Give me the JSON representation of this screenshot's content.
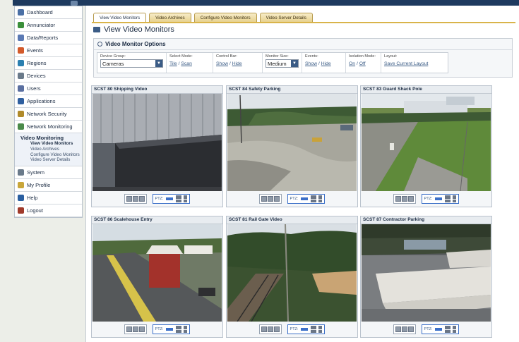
{
  "sidebar": {
    "items": [
      {
        "label": "Dashboard",
        "icon": "dashboard-icon",
        "color": "#4a6fa5"
      },
      {
        "label": "Annunciator",
        "icon": "annunciator-icon",
        "color": "#3a8f3a"
      },
      {
        "label": "Data/Reports",
        "icon": "reports-icon",
        "color": "#5a79b3"
      },
      {
        "label": "Events",
        "icon": "events-icon",
        "color": "#d35a2a"
      },
      {
        "label": "Regions",
        "icon": "regions-icon",
        "color": "#2a7fb0"
      },
      {
        "label": "Devices",
        "icon": "devices-icon",
        "color": "#6a7a8a"
      },
      {
        "label": "Users",
        "icon": "users-icon",
        "color": "#5a6fa0"
      },
      {
        "label": "Applications",
        "icon": "applications-icon",
        "color": "#2f5f9f"
      },
      {
        "label": "Network Security",
        "icon": "network-security-icon",
        "color": "#b08a2a"
      },
      {
        "label": "Network Monitoring",
        "icon": "network-monitoring-icon",
        "color": "#4a8a4a"
      }
    ],
    "video_monitoring": {
      "label": "Video Monitoring",
      "subitems": [
        "View Video Monitors",
        "Video Archives",
        "Configure Video Monitors",
        "Video Server Details"
      ]
    },
    "bottom_items": [
      {
        "label": "System",
        "icon": "system-icon",
        "color": "#6a7a8a"
      },
      {
        "label": "My Profile",
        "icon": "profile-icon",
        "color": "#c9a63a"
      },
      {
        "label": "Help",
        "icon": "help-icon",
        "color": "#2a5fa0"
      },
      {
        "label": "Logout",
        "icon": "logout-icon",
        "color": "#a03a2a"
      }
    ]
  },
  "tabs": [
    "View Video Monitors",
    "Video Archives",
    "Configure Video Monitors",
    "Video Server Details"
  ],
  "page_title": "View Video Monitors",
  "options": {
    "header": "Video Monitor Options",
    "device_group_label": "Device Group:",
    "device_group_value": "Cameras",
    "select_mode_label": "Select Mode:",
    "select_mode_a": "Tile",
    "select_mode_b": "Scan",
    "control_bar_label": "Control Bar:",
    "control_bar_a": "Show",
    "control_bar_b": "Hide",
    "monitor_size_label": "Monitor Size:",
    "monitor_size_value": "Medium",
    "events_label": "Events:",
    "events_a": "Show",
    "events_b": "Hide",
    "isolation_label": "Isolation Mode:",
    "isolation_a": "On",
    "isolation_b": "Off",
    "layout_label": "Layout:",
    "layout_value": "Save Current Layout",
    "separator": "/"
  },
  "cameras": [
    {
      "title": "SCST 80 Shipping Video"
    },
    {
      "title": "SCST 84 Safety Parking"
    },
    {
      "title": "SCST 83 Guard Shack Pole"
    },
    {
      "title": "SCST 86 Scalehouse Entry"
    },
    {
      "title": "SCST 81 Rail Gate Video"
    },
    {
      "title": "SCST 87 Contractor Parking"
    }
  ],
  "ptz_label": "PTZ:",
  "colors": {
    "accent": "#1e3a5f",
    "tab_gold": "#d9b44a",
    "link": "#3b5c86"
  }
}
